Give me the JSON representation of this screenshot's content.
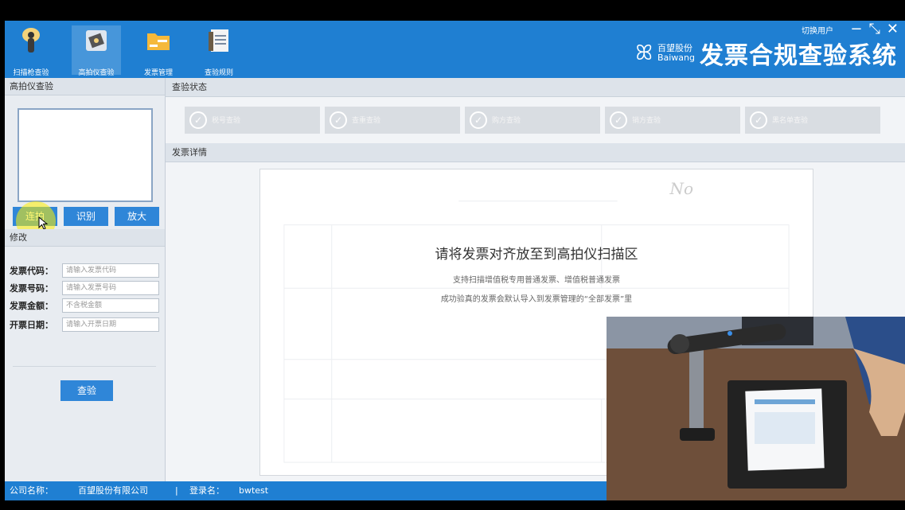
{
  "toolbar": {
    "items": [
      {
        "label": "扫描枪查验",
        "icon": "scanner-gun-icon"
      },
      {
        "label": "高拍仪查验",
        "icon": "document-camera-icon"
      },
      {
        "label": "发票管理",
        "icon": "folder-icon"
      },
      {
        "label": "查验规则",
        "icon": "document-rules-icon"
      }
    ],
    "switch_user": "切换用户",
    "brand_name_cn": "百望股份",
    "brand_name_en": "Baiwang",
    "app_title": "发票合规查验系统"
  },
  "sidebar": {
    "section_title": "高拍仪查验",
    "buttons": {
      "continuous": "连拍",
      "recognize": "识别",
      "zoom": "放大"
    },
    "edit_title": "修改",
    "fields": [
      {
        "label": "发票代码：",
        "placeholder": "请输入发票代码"
      },
      {
        "label": "发票号码：",
        "placeholder": "请输入发票号码"
      },
      {
        "label": "发票金额：",
        "placeholder": "不含税金额"
      },
      {
        "label": "开票日期：",
        "placeholder": "请输入开票日期"
      }
    ],
    "check_button": "查验"
  },
  "main": {
    "status_title": "查验状态",
    "steps": [
      "税号查验",
      "查重查验",
      "购方查验",
      "销方查验",
      "黑名单查验"
    ],
    "details_title": "发票详情",
    "invoice_no_mark": "No",
    "message_title": "请将发票对齐放至到高拍仪扫描区",
    "message_line1": "支持扫描增值税专用普通发票、增值税普通发票",
    "message_line2": "成功验真的发票会默认导入到发票管理的“全部发票”里"
  },
  "statusbar": {
    "company_label": "公司名称：",
    "company_value": "百望股份有限公司",
    "login_label": "登录名：",
    "login_value": "bwtest"
  },
  "colors": {
    "accent": "#1f7fd2",
    "button": "#2f86d8"
  }
}
